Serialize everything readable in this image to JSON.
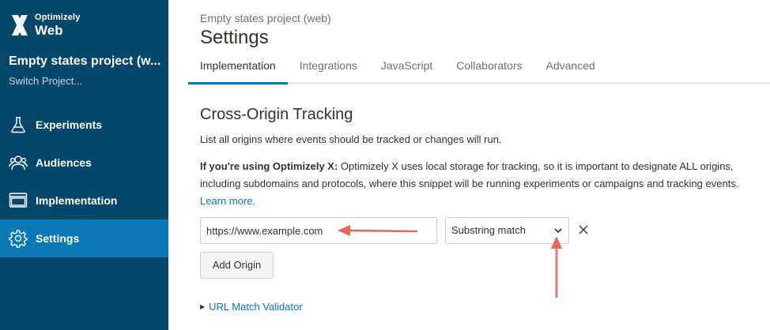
{
  "logo": {
    "brand": "Optimizely",
    "product": "Web"
  },
  "project": {
    "name": "Empty states project (w...",
    "switch_label": "Switch Project..."
  },
  "nav": [
    {
      "label": "Experiments",
      "icon": "flask-icon"
    },
    {
      "label": "Audiences",
      "icon": "audiences-icon"
    },
    {
      "label": "Implementation",
      "icon": "window-icon"
    },
    {
      "label": "Settings",
      "icon": "gear-icon",
      "active": true
    }
  ],
  "header": {
    "breadcrumb": "Empty states project (web)",
    "title": "Settings"
  },
  "tabs": [
    {
      "label": "Implementation",
      "active": true
    },
    {
      "label": "Integrations"
    },
    {
      "label": "JavaScript"
    },
    {
      "label": "Collaborators"
    },
    {
      "label": "Advanced"
    }
  ],
  "section": {
    "title": "Cross-Origin Tracking",
    "description": "List all origins where events should be tracked or changes will run.",
    "note_bold": "If you're using Optimizely X:",
    "note_text": " Optimizely X uses local storage for tracking, so it is important to designate ALL origins, including subdomains and protocols, where this snippet will be running experiments or campaigns and tracking events. ",
    "learn_more": "Learn more."
  },
  "origin": {
    "value": "https://www.example.com",
    "match_type": "Substring match"
  },
  "buttons": {
    "add_origin": "Add Origin"
  },
  "validator_label": "URL Match Validator",
  "colors": {
    "sidebar": "#05466b",
    "active_nav": "#0b78b6",
    "link": "#0b78b6",
    "annotation": "#e8665a"
  }
}
